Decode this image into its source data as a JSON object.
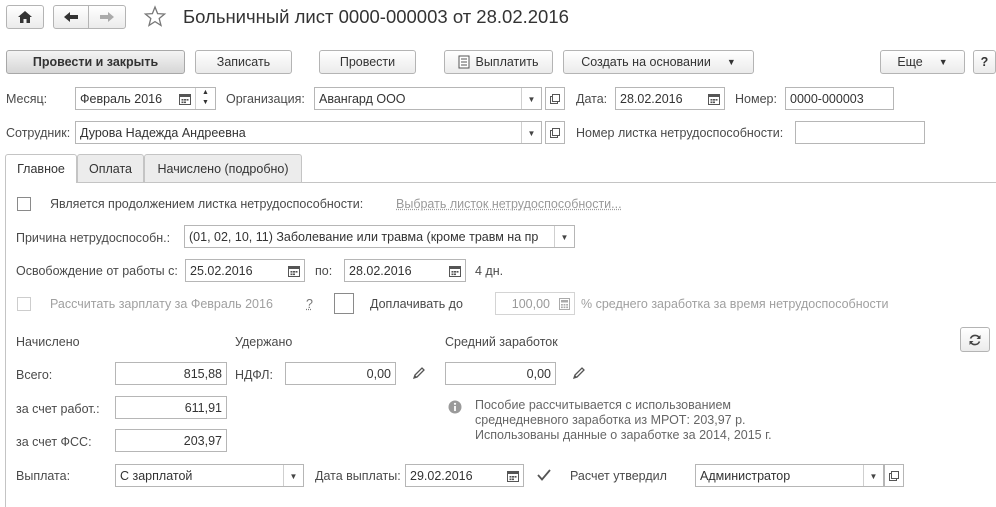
{
  "header": {
    "title": "Больничный лист 0000-000003 от 28.02.2016"
  },
  "toolbar": {
    "post_close": "Провести и закрыть",
    "save": "Записать",
    "post": "Провести",
    "pay": "Выплатить",
    "create_based": "Создать на основании",
    "more": "Еще",
    "help": "?"
  },
  "form": {
    "month_label": "Месяц:",
    "month_value": "Февраль 2016",
    "org_label": "Организация:",
    "org_value": "Авангард ООО",
    "date_label": "Дата:",
    "date_value": "28.02.2016",
    "number_label": "Номер:",
    "number_value": "0000-000003",
    "employee_label": "Сотрудник:",
    "employee_value": "Дурова Надежда Андреевна",
    "sheet_number_label": "Номер листка нетрудоспособности:",
    "sheet_number_value": ""
  },
  "tabs": [
    {
      "label": "Главное"
    },
    {
      "label": "Оплата"
    },
    {
      "label": "Начислено (подробно)"
    }
  ],
  "main": {
    "continuation_label": "Является продолжением листка нетрудоспособности:",
    "choose_link": "Выбрать листок нетрудоспособности...",
    "reason_label": "Причина нетрудоспособн.:",
    "reason_value": "(01, 02, 10, 11) Заболевание или травма (кроме травм на пр",
    "release_label": "Освобождение от работы с:",
    "release_from": "25.02.2016",
    "to_label": "по:",
    "release_to": "28.02.2016",
    "days": "4 дн.",
    "calc_salary_label": "Рассчитать зарплату за Февраль 2016",
    "calc_help": "?",
    "extra_pay_label": "Доплачивать до",
    "extra_pay_value": "100,00",
    "extra_pay_suffix": "% среднего заработка за время нетрудоспособности",
    "accrued_header": "Начислено",
    "withheld_header": "Удержано",
    "avg_header": "Средний заработок",
    "total_label": "Всего:",
    "total_value": "815,88",
    "employer_label": "за счет работ.:",
    "employer_value": "611,91",
    "fss_label": "за счет ФСС:",
    "fss_value": "203,97",
    "ndfl_label": "НДФЛ:",
    "ndfl_value": "0,00",
    "avg_value": "0,00",
    "info_line1": "Пособие рассчитывается с использованием",
    "info_line2": "среднедневного заработка из МРОТ: 203,97 р.",
    "info_line3": "Использованы данные о заработке за  2014,  2015 г.",
    "payout_label": "Выплата:",
    "payout_value": "С зарплатой",
    "payout_date_label": "Дата выплаты:",
    "payout_date_value": "29.02.2016",
    "approved_label": "Расчет утвердил",
    "approved_value": "Администратор"
  }
}
